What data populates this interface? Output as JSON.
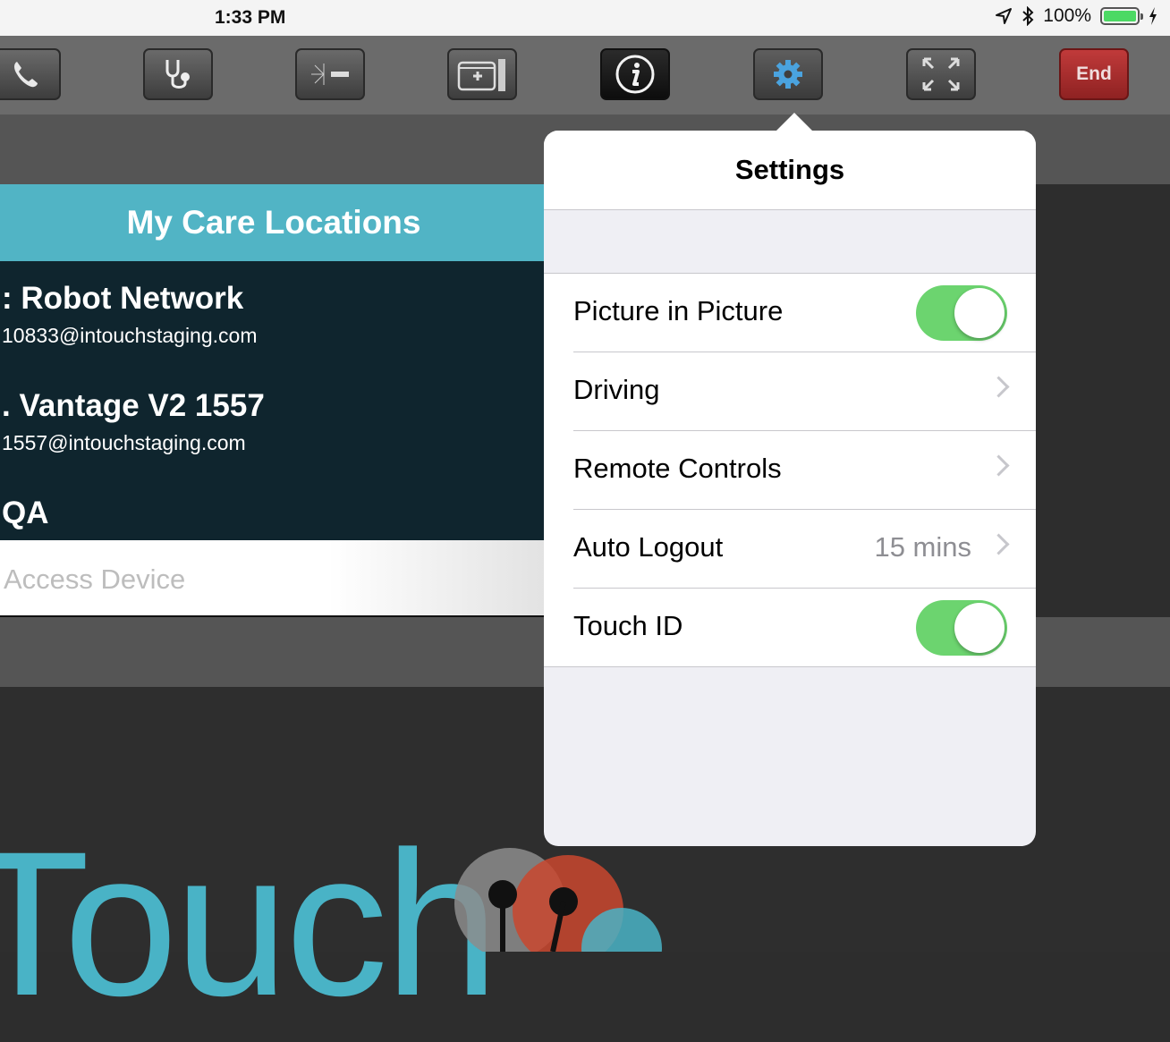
{
  "status_bar": {
    "time": "1:33 PM",
    "battery_percent": "100%",
    "battery_level": 1.0,
    "location_icon": "location-arrow-icon",
    "bluetooth_icon": "bluetooth-icon",
    "charging_icon": "charging-bolt-icon"
  },
  "toolbar": {
    "buttons": [
      {
        "name": "phone",
        "icon": "phone-icon"
      },
      {
        "name": "stethoscope",
        "icon": "stethoscope-icon"
      },
      {
        "name": "laser",
        "icon": "laser-pointer-icon"
      },
      {
        "name": "medical-device",
        "icon": "medical-cart-icon"
      },
      {
        "name": "info",
        "icon": "info-icon"
      },
      {
        "name": "settings",
        "icon": "gear-icon"
      },
      {
        "name": "fullscreen",
        "icon": "expand-icon"
      }
    ],
    "end_label": "End",
    "colors": {
      "end": "#b03030",
      "settings_gear": "#4aa3df"
    }
  },
  "care_locations": {
    "title": "My Care Locations",
    "items": [
      {
        "name": ": Robot Network",
        "email": "10833@intouchstaging.com"
      },
      {
        "name": ". Vantage V2 1557",
        "email": "1557@intouchstaging.com"
      },
      {
        "name": "QA",
        "email": ""
      }
    ],
    "access_placeholder": "Access Device"
  },
  "settings": {
    "title": "Settings",
    "rows": [
      {
        "label": "Picture in Picture",
        "type": "toggle",
        "on": true
      },
      {
        "label": "Driving",
        "type": "disclosure"
      },
      {
        "label": "Remote Controls",
        "type": "disclosure"
      },
      {
        "label": "Auto Logout",
        "type": "disclosure",
        "value": "15 mins"
      },
      {
        "label": "Touch ID",
        "type": "toggle",
        "on": true
      }
    ],
    "toggle_color": "#6cd46f"
  },
  "logo": {
    "text": "Touch",
    "color": "#49b3c6"
  }
}
